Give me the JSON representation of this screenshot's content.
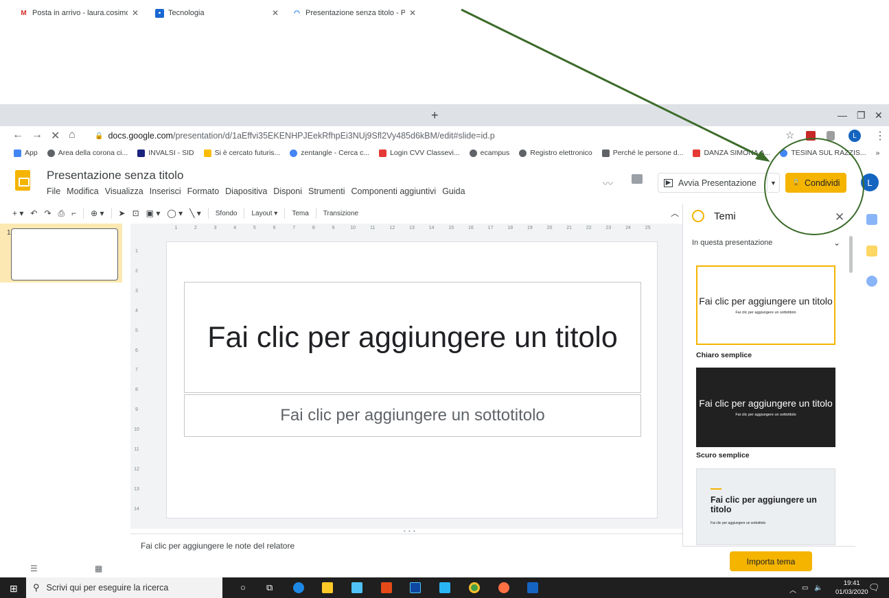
{
  "browser": {
    "tabs": [
      {
        "label": "Posta in arrivo - laura.cosimo@ic"
      },
      {
        "label": "Tecnologia"
      },
      {
        "label": "Presentazione senza titolo - Pres"
      }
    ],
    "new_tab": "+",
    "url_host": "docs.google.com",
    "url_path": "/presentation/d/1aEffvi35EKENHPJEekRfhpEi3NUj9Sfl2Vy485d6kBM/edit#slide=id.p",
    "profile_initial": "L",
    "bookmarks": [
      {
        "label": "App",
        "color": "#4285f4"
      },
      {
        "label": "Area della corona ci...",
        "color": "#5f6368"
      },
      {
        "label": "INVALSI - SID",
        "color": "#1a237e"
      },
      {
        "label": "Si è cercato futuris...",
        "color": "#fbbc04"
      },
      {
        "label": "zentangle - Cerca c...",
        "color": "#4285f4"
      },
      {
        "label": "Login CVV Classevi...",
        "color": "#e53935"
      },
      {
        "label": "ecampus",
        "color": "#5f6368"
      },
      {
        "label": "Registro elettronico",
        "color": "#5f6368"
      },
      {
        "label": "Perché le persone d...",
        "color": "#5f6368"
      },
      {
        "label": "DANZA SIMONA A...",
        "color": "#e53935"
      },
      {
        "label": "TESINA SUL RAZZIS...",
        "color": "#4285f4"
      }
    ],
    "bookmarks_more": "»"
  },
  "doc": {
    "title": "Presentazione senza titolo",
    "menu": [
      "File",
      "Modifica",
      "Visualizza",
      "Inserisci",
      "Formato",
      "Diapositiva",
      "Disponi",
      "Strumenti",
      "Componenti aggiuntivi",
      "Guida"
    ],
    "present_label": "Avvia Presentazione",
    "share_label": "Condividi",
    "avatar_initial": "L"
  },
  "toolbar": {
    "background": "Sfondo",
    "layout": "Layout",
    "theme": "Tema",
    "transition": "Transizione"
  },
  "filmstrip": {
    "slide_number": "1"
  },
  "ruler_h": [
    "1",
    "2",
    "3",
    "4",
    "5",
    "6",
    "7",
    "8",
    "9",
    "10",
    "11",
    "12",
    "13",
    "14",
    "15",
    "16",
    "17",
    "18",
    "19",
    "20",
    "21",
    "22",
    "23",
    "24",
    "25"
  ],
  "ruler_v": [
    "1",
    "2",
    "3",
    "4",
    "5",
    "6",
    "7",
    "8",
    "9",
    "10",
    "11",
    "12",
    "13",
    "14"
  ],
  "slide": {
    "title_placeholder": "Fai clic per aggiungere un titolo",
    "subtitle_placeholder": "Fai clic per aggiungere un sottotitolo"
  },
  "notes": {
    "placeholder": "Fai clic per aggiungere le note del relatore"
  },
  "themes_panel": {
    "title": "Temi",
    "filter": "In questa presentazione",
    "themes": [
      {
        "name": "Chiaro semplice",
        "title": "Fai clic per aggiungere un titolo",
        "subtitle": "Fai clic per aggiungere un sottotitolo"
      },
      {
        "name": "Scuro semplice",
        "title": "Fai clic per aggiungere un titolo",
        "subtitle": "Fai clic per aggiungere un sottotitolo"
      },
      {
        "name": "",
        "title": "Fai clic per aggiungere un titolo",
        "subtitle": "Fai clic per aggiungere un sottotitolo"
      }
    ],
    "import_label": "Importa tema"
  },
  "taskbar": {
    "search_placeholder": "Scrivi qui per eseguire la ricerca",
    "time": "19:41",
    "date": "01/03/2020"
  },
  "colors": {
    "accent": "#f4b400",
    "annotation": "#3b6b2a",
    "brand_blue": "#1565c0"
  }
}
